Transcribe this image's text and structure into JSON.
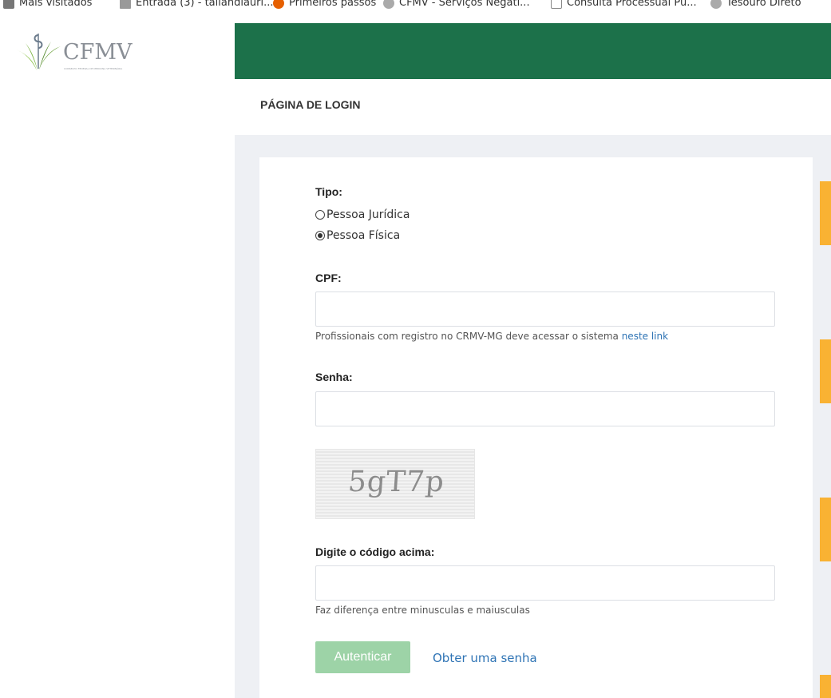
{
  "bookmarks": [
    {
      "label": "Mais visitados",
      "icon": "gear-icon",
      "color": "#888888"
    },
    {
      "label": "Entrada (3) - tallandiauri...",
      "icon": "mail-icon",
      "color": "#888888"
    },
    {
      "label": "Primeiros passos",
      "icon": "firefox-icon",
      "color": "#e66000"
    },
    {
      "label": "CFMV - Serviços Negati...",
      "icon": "globe-icon",
      "color": "#888888"
    },
    {
      "label": "Consulta Processual Pu...",
      "icon": "arrow-icon",
      "color": "#888888"
    },
    {
      "label": "Tesouro Direto",
      "icon": "globe-icon",
      "color": "#888888"
    }
  ],
  "logo": {
    "text": "CFMV",
    "subtitle": "CONSELHO FEDERAL DE MEDICINA VETERINÁRIA",
    "color": "#8a8f96"
  },
  "header": {
    "color": "#1c714a"
  },
  "page": {
    "title": "PÁGINA DE LOGIN"
  },
  "form": {
    "tipo_label": "Tipo:",
    "tipo_options": [
      {
        "label": "Pessoa Jurídica",
        "selected": false
      },
      {
        "label": "Pessoa Física",
        "selected": true
      }
    ],
    "cpf_label": "CPF:",
    "cpf_value": "",
    "cpf_help_text": "Profissionais com registro no CRMV-MG deve acessar o sistema",
    "cpf_help_link": "neste link",
    "senha_label": "Senha:",
    "senha_value": "",
    "captcha_text": "5gT7p",
    "codigo_label": "Digite o código acima:",
    "codigo_value": "",
    "codigo_help": "Faz diferença entre minusculas e maiusculas",
    "submit_label": "Autenticar",
    "obter_senha_label": "Obter uma senha"
  },
  "colors": {
    "accent": "#f9b233",
    "button": "#9dd3a7",
    "link": "#2f74b5"
  }
}
